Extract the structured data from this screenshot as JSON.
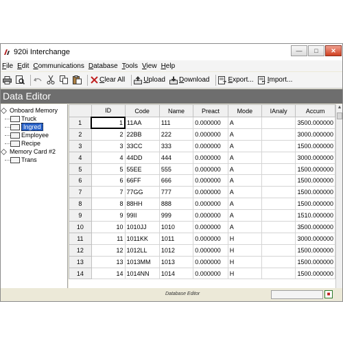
{
  "window": {
    "title": "920i Interchange"
  },
  "menu": [
    {
      "first": "F",
      "rest": "ile"
    },
    {
      "first": "E",
      "rest": "dit"
    },
    {
      "first": "C",
      "rest": "ommunications"
    },
    {
      "first": "D",
      "rest": "atabase"
    },
    {
      "first": "T",
      "rest": "ools"
    },
    {
      "first": "V",
      "rest": "iew"
    },
    {
      "first": "H",
      "rest": "elp"
    }
  ],
  "toolbar": {
    "icons": [
      "print-icon",
      "print-preview-icon",
      "undo-icon",
      "cut-icon",
      "copy-icon",
      "paste-icon"
    ],
    "clear_all": {
      "u": "C",
      "rest": "lear All"
    },
    "upload": {
      "u": "U",
      "rest": "pload"
    },
    "download": {
      "u": "D",
      "rest": "ownload"
    },
    "export": {
      "u": "E",
      "rest": "xport..."
    },
    "import": {
      "u": "I",
      "rest": "mport..."
    }
  },
  "editor_title": "Data Editor",
  "tree": {
    "onboard": "Onboard Memory",
    "onboard_items": [
      "Truck",
      "Ingred",
      "Employee",
      "Recipe"
    ],
    "selected": "Ingred",
    "card": "Memory Card #2",
    "card_items": [
      "Trans"
    ]
  },
  "grid": {
    "columns": [
      "ID",
      "Code",
      "Name",
      "Preact",
      "Mode",
      "IAnaly",
      "Accum"
    ],
    "rows": [
      [
        "1",
        "1",
        "11AA",
        "111",
        "0.000000",
        "A",
        "",
        "3500.000000"
      ],
      [
        "2",
        "2",
        "22BB",
        "222",
        "0.000000",
        "A",
        "",
        "3000.000000"
      ],
      [
        "3",
        "3",
        "33CC",
        "333",
        "0.000000",
        "A",
        "",
        "1500.000000"
      ],
      [
        "4",
        "4",
        "44DD",
        "444",
        "0.000000",
        "A",
        "",
        "3000.000000"
      ],
      [
        "5",
        "5",
        "55EE",
        "555",
        "0.000000",
        "A",
        "",
        "1500.000000"
      ],
      [
        "6",
        "6",
        "66FF",
        "666",
        "0.000000",
        "A",
        "",
        "1500.000000"
      ],
      [
        "7",
        "7",
        "77GG",
        "777",
        "0.000000",
        "A",
        "",
        "1500.000000"
      ],
      [
        "8",
        "8",
        "88HH",
        "888",
        "0.000000",
        "A",
        "",
        "1500.000000"
      ],
      [
        "9",
        "9",
        "99II",
        "999",
        "0.000000",
        "A",
        "",
        "1510.000000"
      ],
      [
        "10",
        "10",
        "1010JJ",
        "1010",
        "0.000000",
        "A",
        "",
        "3500.000000"
      ],
      [
        "11",
        "11",
        "1011KK",
        "1011",
        "0.000000",
        "H",
        "",
        "3000.000000"
      ],
      [
        "12",
        "12",
        "1012LL",
        "1012",
        "0.000000",
        "H",
        "",
        "1500.000000"
      ],
      [
        "13",
        "13",
        "1013MM",
        "1013",
        "0.000000",
        "H",
        "",
        "1500.000000"
      ],
      [
        "14",
        "14",
        "1014NN",
        "1014",
        "0.000000",
        "H",
        "",
        "1500.000000"
      ]
    ]
  },
  "status": {
    "label": "Database Editor"
  },
  "colors": {
    "header_bg": "#6e6e6e",
    "selection": "#2b63c8",
    "close_button": "#d04020"
  }
}
